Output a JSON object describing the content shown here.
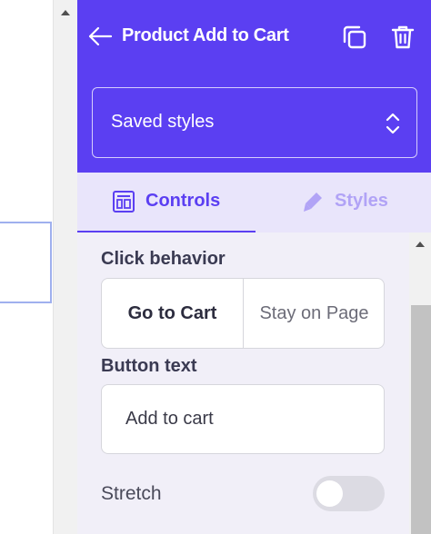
{
  "header": {
    "title": "Product Add to Cart",
    "back_icon": "arrow-left-icon",
    "duplicate_icon": "copy-icon",
    "delete_icon": "trash-icon",
    "saved_styles": {
      "label": "Saved styles",
      "icon": "chevron-up-down-icon"
    }
  },
  "tabs": [
    {
      "label": "Controls",
      "icon": "layout-icon",
      "active": true
    },
    {
      "label": "Styles",
      "icon": "brush-icon",
      "active": false
    }
  ],
  "controls": {
    "click_behavior": {
      "label": "Click behavior",
      "options": [
        "Go to Cart",
        "Stay on Page"
      ],
      "selected": "Go to Cart"
    },
    "button_text": {
      "label": "Button text",
      "value": "Add to cart"
    },
    "stretch": {
      "label": "Stretch",
      "enabled": false
    }
  },
  "colors": {
    "accent": "#5b3ff2",
    "tab_bg": "#e9e5fb",
    "panel_bg": "#f1eff8",
    "inactive_tab": "#b1a3f6"
  }
}
